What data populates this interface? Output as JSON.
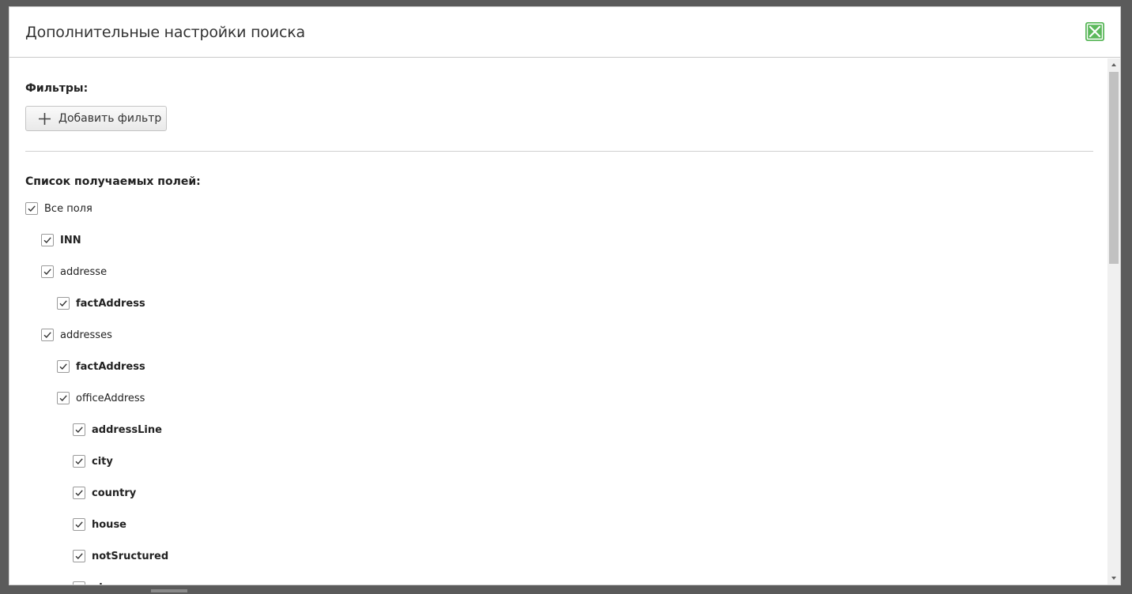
{
  "dialog": {
    "title": "Дополнительные настройки поиска",
    "close_icon": "close-x-icon",
    "accent_color": "#5cb85c"
  },
  "filters": {
    "heading": "Фильтры:",
    "add_button_label": "Добавить фильтр",
    "add_icon": "plus-icon"
  },
  "fields": {
    "heading": "Список получаемых полей:",
    "items": [
      {
        "label": "Все поля",
        "checked": true,
        "depth": 0,
        "leaf": false
      },
      {
        "label": "INN",
        "checked": true,
        "depth": 1,
        "leaf": true
      },
      {
        "label": "addresse",
        "checked": true,
        "depth": 1,
        "leaf": false
      },
      {
        "label": "factAddress",
        "checked": true,
        "depth": 2,
        "leaf": true
      },
      {
        "label": "addresses",
        "checked": true,
        "depth": 1,
        "leaf": false
      },
      {
        "label": "factAddress",
        "checked": true,
        "depth": 2,
        "leaf": true
      },
      {
        "label": "officeAddress",
        "checked": true,
        "depth": 2,
        "leaf": false
      },
      {
        "label": "addressLine",
        "checked": true,
        "depth": 3,
        "leaf": true
      },
      {
        "label": "city",
        "checked": true,
        "depth": 3,
        "leaf": true
      },
      {
        "label": "country",
        "checked": true,
        "depth": 3,
        "leaf": true
      },
      {
        "label": "house",
        "checked": true,
        "depth": 3,
        "leaf": true
      },
      {
        "label": "notSructured",
        "checked": true,
        "depth": 3,
        "leaf": true
      },
      {
        "label": "place",
        "checked": true,
        "depth": 3,
        "leaf": true
      }
    ]
  }
}
